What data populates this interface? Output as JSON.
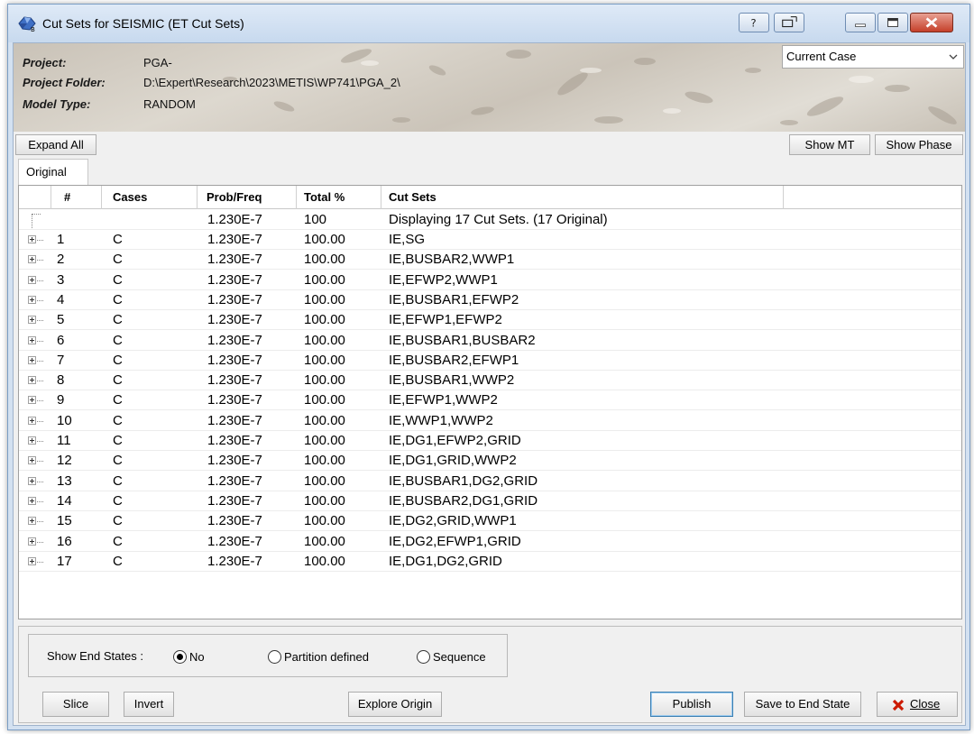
{
  "window": {
    "title": "Cut Sets for SEISMIC (ET Cut Sets)"
  },
  "header": {
    "project_label": "Project:",
    "project_value": "PGA-",
    "folder_label": "Project Folder:",
    "folder_value": "D:\\Expert\\Research\\2023\\METIS\\WP741\\PGA_2\\",
    "model_label": "Model Type:",
    "model_value": "RANDOM",
    "case_select": "Current Case"
  },
  "toolbar": {
    "expand_all": "Expand All",
    "show_mt": "Show MT",
    "show_phase": "Show Phase"
  },
  "tabs": [
    {
      "label": "Original"
    }
  ],
  "table": {
    "columns": [
      "#",
      "Cases",
      "Prob/Freq",
      "Total %",
      "Cut Sets"
    ],
    "summary": {
      "prob": "1.230E-7",
      "total": "100",
      "cutsets": "Displaying 17 Cut Sets. (17 Original)"
    },
    "rows": [
      {
        "num": "1",
        "case": "C",
        "prob": "1.230E-7",
        "total": "100.00",
        "cutsets": "IE,SG"
      },
      {
        "num": "2",
        "case": "C",
        "prob": "1.230E-7",
        "total": "100.00",
        "cutsets": "IE,BUSBAR2,WWP1"
      },
      {
        "num": "3",
        "case": "C",
        "prob": "1.230E-7",
        "total": "100.00",
        "cutsets": "IE,EFWP2,WWP1"
      },
      {
        "num": "4",
        "case": "C",
        "prob": "1.230E-7",
        "total": "100.00",
        "cutsets": "IE,BUSBAR1,EFWP2"
      },
      {
        "num": "5",
        "case": "C",
        "prob": "1.230E-7",
        "total": "100.00",
        "cutsets": "IE,EFWP1,EFWP2"
      },
      {
        "num": "6",
        "case": "C",
        "prob": "1.230E-7",
        "total": "100.00",
        "cutsets": "IE,BUSBAR1,BUSBAR2"
      },
      {
        "num": "7",
        "case": "C",
        "prob": "1.230E-7",
        "total": "100.00",
        "cutsets": "IE,BUSBAR2,EFWP1"
      },
      {
        "num": "8",
        "case": "C",
        "prob": "1.230E-7",
        "total": "100.00",
        "cutsets": "IE,BUSBAR1,WWP2"
      },
      {
        "num": "9",
        "case": "C",
        "prob": "1.230E-7",
        "total": "100.00",
        "cutsets": "IE,EFWP1,WWP2"
      },
      {
        "num": "10",
        "case": "C",
        "prob": "1.230E-7",
        "total": "100.00",
        "cutsets": "IE,WWP1,WWP2"
      },
      {
        "num": "11",
        "case": "C",
        "prob": "1.230E-7",
        "total": "100.00",
        "cutsets": "IE,DG1,EFWP2,GRID"
      },
      {
        "num": "12",
        "case": "C",
        "prob": "1.230E-7",
        "total": "100.00",
        "cutsets": "IE,DG1,GRID,WWP2"
      },
      {
        "num": "13",
        "case": "C",
        "prob": "1.230E-7",
        "total": "100.00",
        "cutsets": "IE,BUSBAR1,DG2,GRID"
      },
      {
        "num": "14",
        "case": "C",
        "prob": "1.230E-7",
        "total": "100.00",
        "cutsets": "IE,BUSBAR2,DG1,GRID"
      },
      {
        "num": "15",
        "case": "C",
        "prob": "1.230E-7",
        "total": "100.00",
        "cutsets": "IE,DG2,GRID,WWP1"
      },
      {
        "num": "16",
        "case": "C",
        "prob": "1.230E-7",
        "total": "100.00",
        "cutsets": "IE,DG2,EFWP1,GRID"
      },
      {
        "num": "17",
        "case": "C",
        "prob": "1.230E-7",
        "total": "100.00",
        "cutsets": "IE,DG1,DG2,GRID"
      }
    ]
  },
  "end_states": {
    "label": "Show End States :",
    "options": [
      {
        "label": "No",
        "selected": true
      },
      {
        "label": "Partition defined",
        "selected": false
      },
      {
        "label": "Sequence",
        "selected": false
      }
    ]
  },
  "buttons": {
    "slice": "Slice",
    "invert": "Invert",
    "explore_origin": "Explore Origin",
    "publish": "Publish",
    "save_end_state": "Save to End State",
    "close": "Close"
  },
  "colors": {
    "close_x": "#cc1a00",
    "title_bar": "#d3e1f1"
  }
}
